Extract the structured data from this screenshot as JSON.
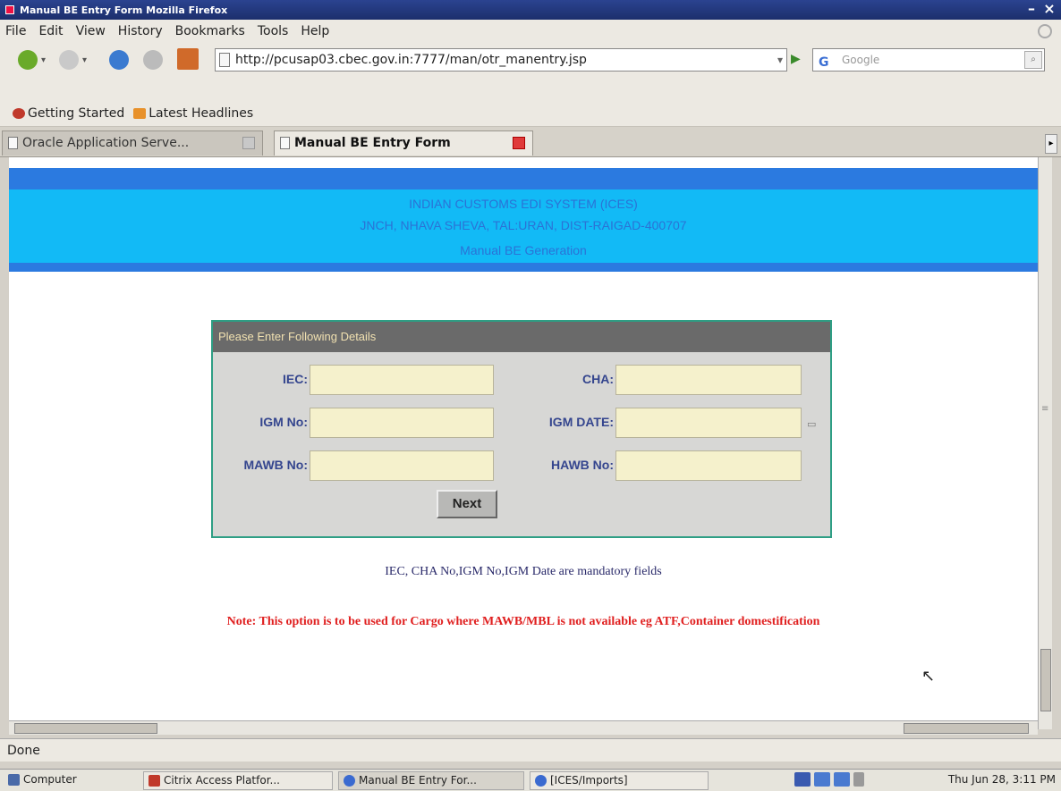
{
  "window": {
    "title": "Manual BE Entry Form   Mozilla Firefox"
  },
  "menu": [
    "File",
    "Edit",
    "View",
    "History",
    "Bookmarks",
    "Tools",
    "Help"
  ],
  "nav": {
    "url": "http://pcusap03.cbec.gov.in:7777/man/otr_manentry.jsp",
    "search_placeholder": "Google"
  },
  "bookmarks": [
    "Getting Started",
    "Latest Headlines"
  ],
  "tabs": [
    {
      "label": "Oracle Application Serve..."
    },
    {
      "label": "Manual BE Entry Form"
    }
  ],
  "page": {
    "header": {
      "line1": "INDIAN CUSTOMS EDI SYSTEM (ICES)",
      "line2": "JNCH, NHAVA SHEVA, TAL:URAN, DIST-RAIGAD-400707",
      "line3": "Manual BE Generation"
    },
    "form": {
      "panel_title": "Please Enter Following Details",
      "iec_label": "IEC:",
      "cha_label": "CHA:",
      "igm_no_label": "IGM No:",
      "igm_date_label": "IGM DATE:",
      "mawb_label": "MAWB No:",
      "hawb_label": "HAWB No:",
      "next_label": "Next"
    },
    "mandatory_text": "IEC, CHA No,IGM No,IGM Date are mandatory fields",
    "note_text": "Note: This option is to be used for Cargo where MAWB/MBL is not available eg ATF,Container domestification"
  },
  "status": "Done",
  "taskbar": {
    "start": "Computer",
    "items": [
      "Citrix Access Platfor...",
      "Manual BE Entry For...",
      "[ICES/Imports]"
    ],
    "clock": "Thu Jun 28, 3:11 PM"
  },
  "colors": {
    "header_band": "#12baf6",
    "header_text": "#2b72d6",
    "note_red": "#e02020",
    "field_bg": "#f5f1cc"
  }
}
